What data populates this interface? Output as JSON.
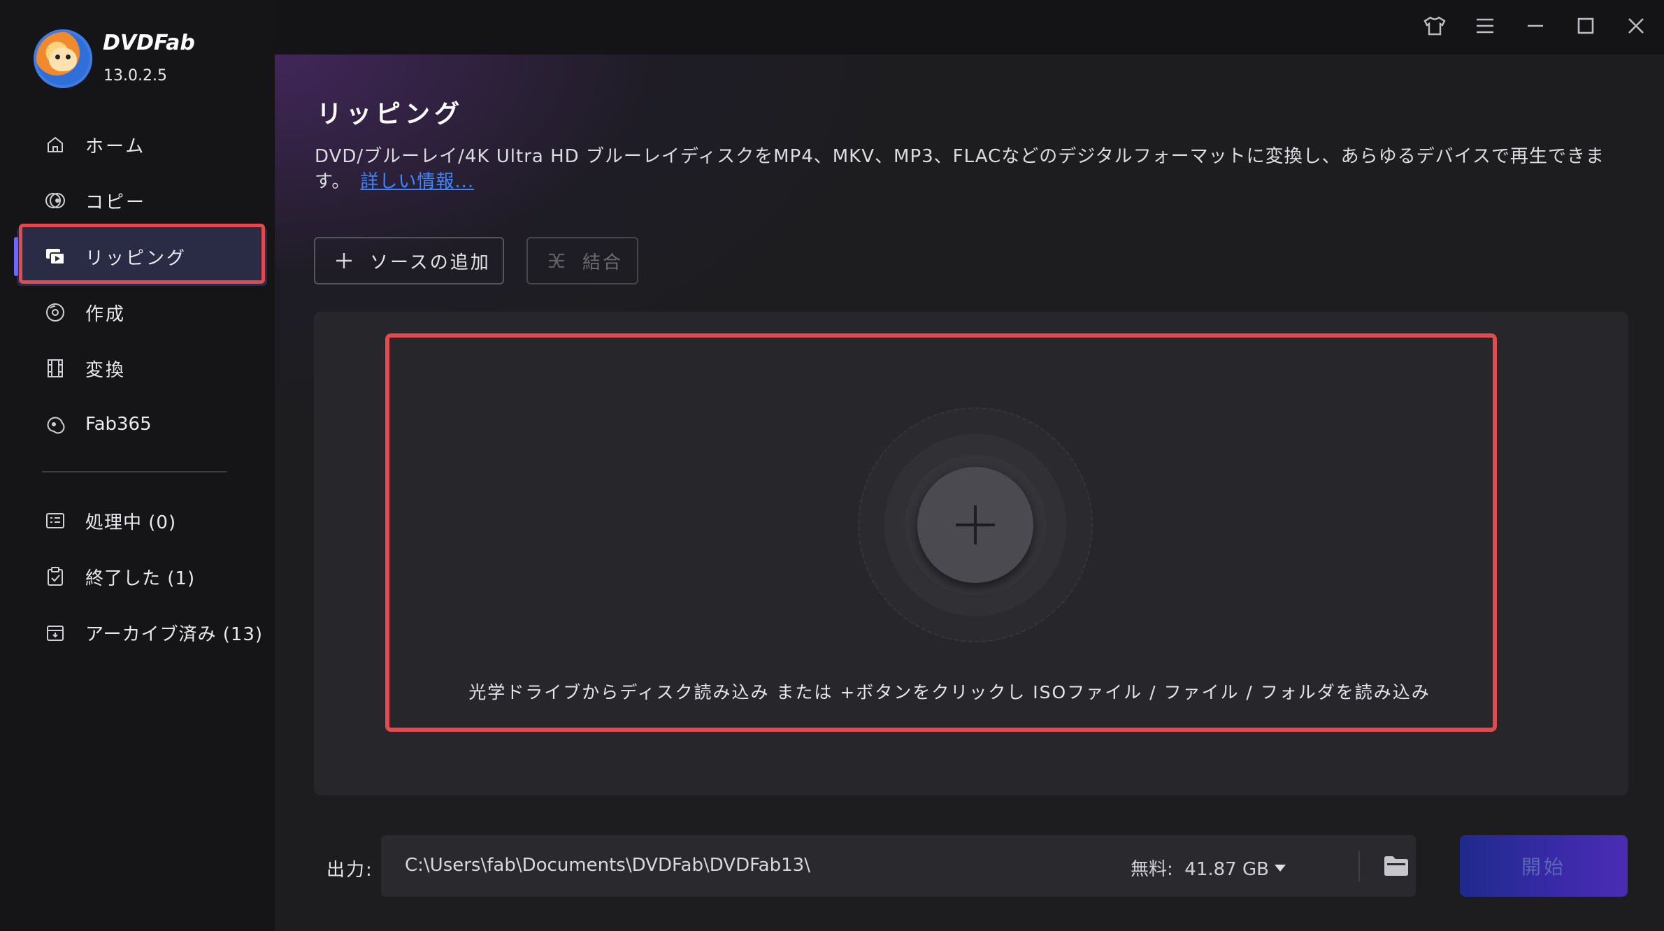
{
  "app": {
    "name": "DVDFab",
    "version": "13.0.2.5"
  },
  "sidebar": {
    "items": [
      {
        "label": "ホーム",
        "icon": "home-icon"
      },
      {
        "label": "コピー",
        "icon": "copy-disc-icon"
      },
      {
        "label": "リッピング",
        "icon": "ripper-icon",
        "active": true
      },
      {
        "label": "作成",
        "icon": "creator-disc-icon"
      },
      {
        "label": "変換",
        "icon": "film-icon"
      },
      {
        "label": "Fab365",
        "icon": "fab365-icon"
      }
    ],
    "tasks": [
      {
        "label": "処理中 (0)",
        "icon": "processing-list-icon"
      },
      {
        "label": "終了した (1)",
        "icon": "finished-clipboard-icon"
      },
      {
        "label": "アーカイブ済み (13)",
        "icon": "archive-box-icon"
      }
    ]
  },
  "titlebar": {
    "buttons": [
      "shirt-icon",
      "menu-icon",
      "minimize-icon",
      "maximize-icon",
      "close-icon"
    ]
  },
  "main": {
    "title": "リッピング",
    "description": "DVD/ブルーレイ/4K Ultra HD ブルーレイディスクをMP4、MKV、MP3、FLACなどのデジタルフォーマットに変換し、あらゆるデバイスで再生できます。",
    "more_link": "詳しい情報...",
    "add_source_label": "ソースの追加",
    "merge_label": "結合",
    "drop_hint": "光学ドライブからディスク読み込み または +ボタンをクリックし ISOファイル / ファイル / フォルダを読み込み"
  },
  "output": {
    "label": "出力:",
    "path": "C:\\Users\\fab\\Documents\\DVDFab\\DVDFab13\\",
    "free_space": "無料:  41.87 GB",
    "start_label": "開始"
  },
  "colors": {
    "highlight_red": "#e34a4e",
    "accent_purple": "#6f66ff",
    "link_blue": "#3d86ff",
    "start_gradient_start": "#1e2a8c",
    "start_gradient_end": "#4a2cb4"
  }
}
